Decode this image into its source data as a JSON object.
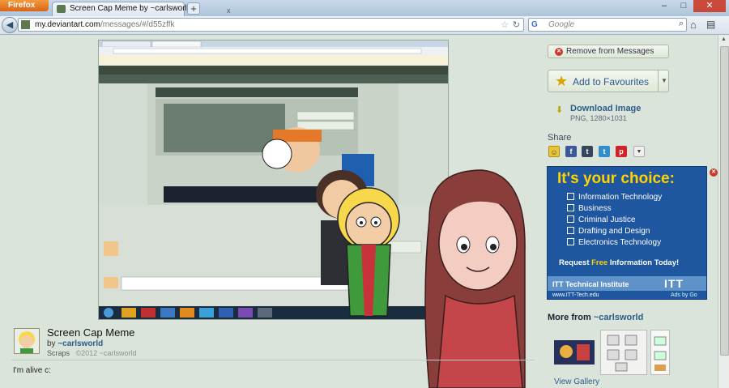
{
  "browser": {
    "menu_label": "Firefox",
    "tab_title": "Screen Cap Meme by ~carlsworld",
    "tab_close": "x",
    "new_tab": "+",
    "url_host": "my.deviantart.com",
    "url_path": "/messages/#/d55zffk",
    "search_engine": "G",
    "search_placeholder": "Google",
    "window_controls": [
      "–",
      "□",
      "✕"
    ]
  },
  "deviation": {
    "title": "Screen Cap Meme",
    "by_prefix": "by",
    "author": "~carlsworld",
    "category": "Scraps",
    "copyright": "©2012 ~carlsworld",
    "description": "I'm alive c:"
  },
  "sidebar": {
    "remove_label": "Remove from Messages",
    "favourite_label": "Add to Favourites",
    "download_label": "Download Image",
    "download_info": "PNG, 1280×1031",
    "share_title": "Share",
    "more_from_prefix": "More from",
    "more_from_author": "~carlsworld",
    "view_gallery": "View Gallery"
  },
  "ad": {
    "headline": "It's your choice:",
    "items": [
      "Information Technology",
      "Business",
      "Criminal Justice",
      "Drafting and Design",
      "Electronics Technology"
    ],
    "request_prefix": "Request ",
    "request_free": "Free",
    "request_suffix": " Information Today!",
    "institute": "ITT Technical Institute",
    "logo": "ITT",
    "url": "www.ITT-Tech.edu",
    "ads_by": "Ads by Go"
  },
  "colors": {
    "page_bg": "#dbe4da",
    "link": "#2b5d8a",
    "ad_bg": "#1e56a0",
    "ad_yellow": "#ffd200",
    "firefox_orange": "#e87a25"
  }
}
